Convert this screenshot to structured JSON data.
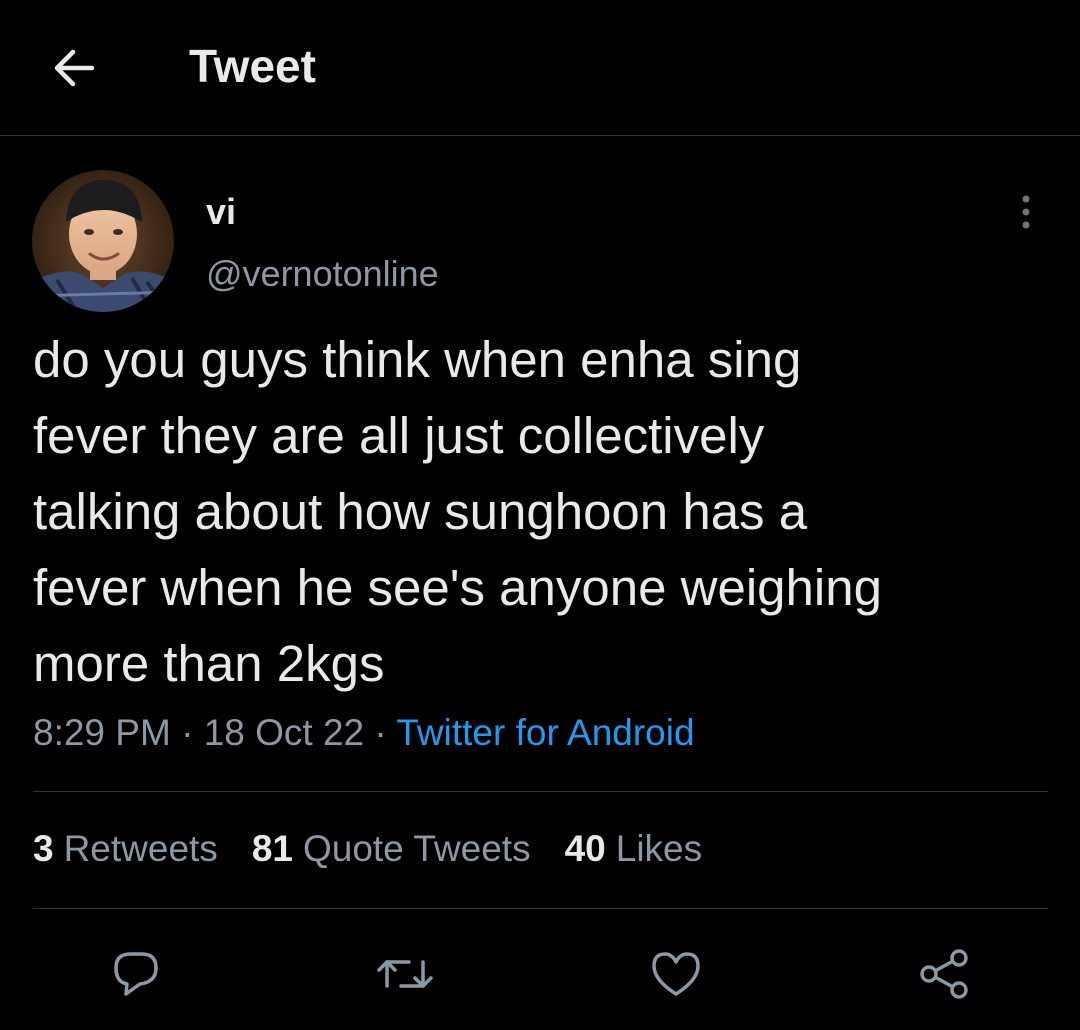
{
  "header": {
    "title": "Tweet",
    "back_icon": "arrow-left-icon"
  },
  "author": {
    "display_name": "vi",
    "handle": "@vernotonline",
    "avatar_icon": "avatar-photo"
  },
  "more_icon": "more-vertical-icon",
  "tweet": {
    "text": "do you guys think when enha sing\nfever they are all just collectively\ntalking about how sunghoon has a\nfever when he see's anyone weighing\nmore than 2kgs",
    "time": "8:29 PM",
    "separator": "·",
    "date": "18 Oct 22",
    "source": "Twitter for Android"
  },
  "stats": {
    "retweets_count": "3",
    "retweets_label": "Retweets",
    "quotes_count": "81",
    "quotes_label": "Quote Tweets",
    "likes_count": "40",
    "likes_label": "Likes"
  },
  "actions": {
    "reply_icon": "reply-icon",
    "retweet_icon": "retweet-icon",
    "like_icon": "heart-icon",
    "share_icon": "share-icon"
  },
  "colors": {
    "background": "#000000",
    "primary_text": "#e7e9ea",
    "secondary_text": "#8b98a5",
    "link": "#1d9bf0",
    "divider": "#2f3336"
  }
}
